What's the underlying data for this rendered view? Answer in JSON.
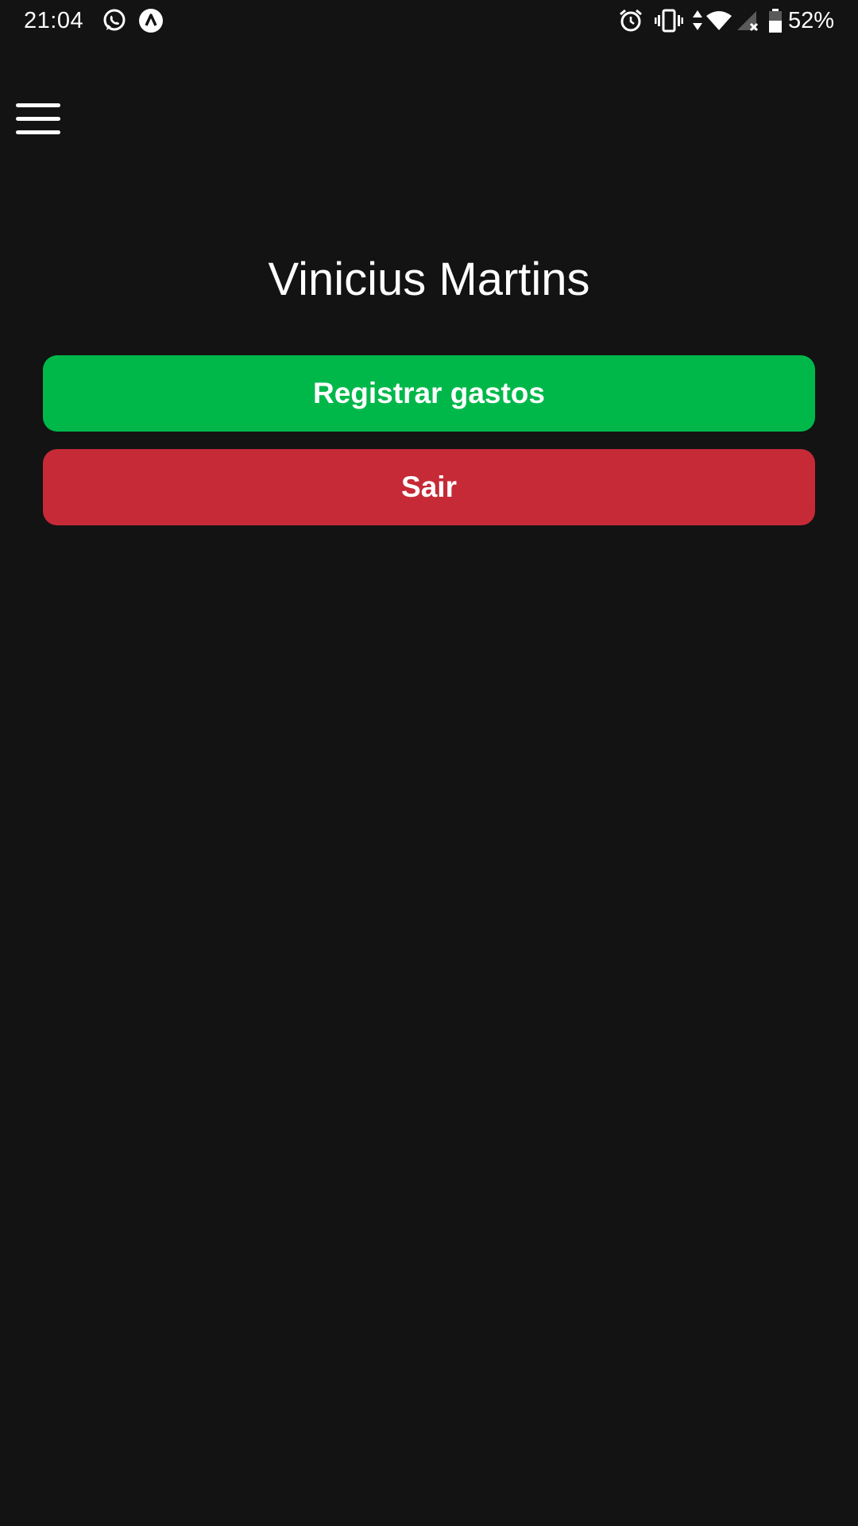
{
  "status_bar": {
    "time": "21:04",
    "battery_percent": "52%",
    "left_icons": [
      "whatsapp-icon",
      "app-notification-icon"
    ],
    "right_icons": [
      "alarm-icon",
      "vibrate-icon",
      "data-arrows-icon",
      "wifi-icon",
      "no-signal-icon",
      "battery-icon"
    ]
  },
  "header": {
    "menu_icon": "hamburger-menu-icon"
  },
  "profile": {
    "name": "Vinicius Martins"
  },
  "actions": {
    "register_label": "Registrar gastos",
    "logout_label": "Sair"
  },
  "colors": {
    "background": "#131313",
    "register_button": "#00b84a",
    "logout_button": "#c62a36",
    "text": "#ffffff"
  }
}
